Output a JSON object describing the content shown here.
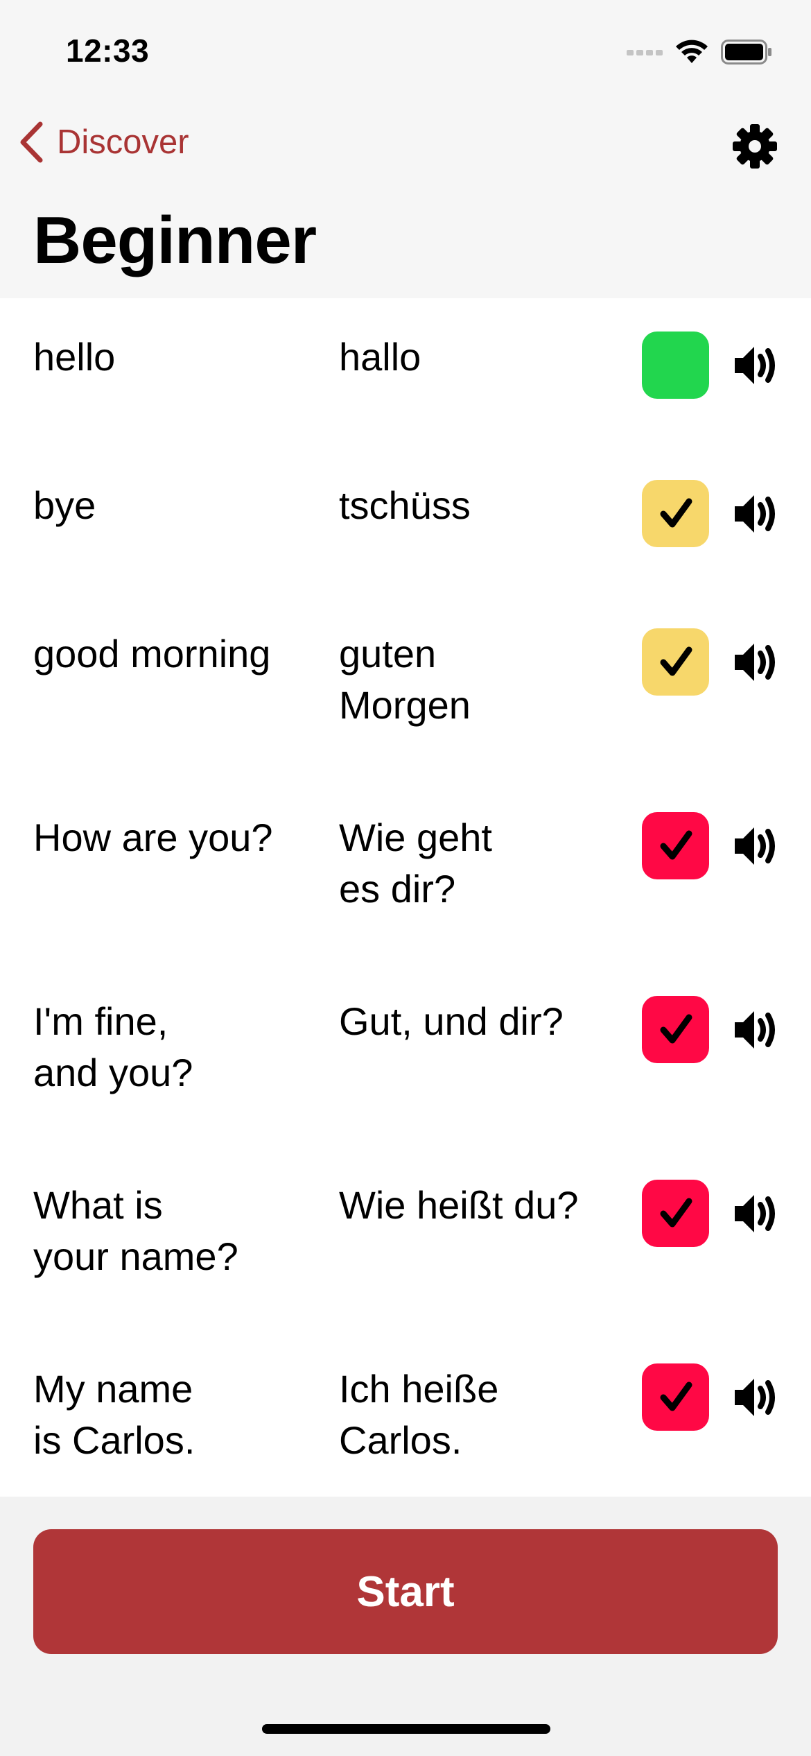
{
  "status_bar": {
    "time": "12:33"
  },
  "nav": {
    "back_label": "Discover"
  },
  "title": "Beginner",
  "colors": {
    "accent": "#a93434",
    "start_button": "#b03638",
    "status_green": "#22d64e",
    "status_yellow": "#f7d76b",
    "status_red": "#ff0845"
  },
  "phrases": [
    {
      "english": "hello",
      "german": "hallo",
      "status": "green",
      "checked": false,
      "icon": "speaker-icon"
    },
    {
      "english": "bye",
      "german": "tschüss",
      "status": "yellow",
      "checked": true,
      "icon": "speaker-icon"
    },
    {
      "english": "good morning",
      "german": "guten\nMorgen",
      "status": "yellow",
      "checked": true,
      "icon": "speaker-icon"
    },
    {
      "english": "How are you?",
      "german": "Wie geht\nes dir?",
      "status": "red",
      "checked": true,
      "icon": "speaker-icon"
    },
    {
      "english": "I'm fine,\nand you?",
      "german": "Gut, und dir?",
      "status": "red",
      "checked": true,
      "icon": "speaker-icon"
    },
    {
      "english": "What is\nyour name?",
      "german": "Wie heißt du?",
      "status": "red",
      "checked": true,
      "icon": "speaker-icon"
    },
    {
      "english": "My name\nis Carlos.",
      "german": "Ich heiße\nCarlos.",
      "status": "red",
      "checked": true,
      "icon": "speaker-icon"
    }
  ],
  "start_button": {
    "label": "Start"
  }
}
